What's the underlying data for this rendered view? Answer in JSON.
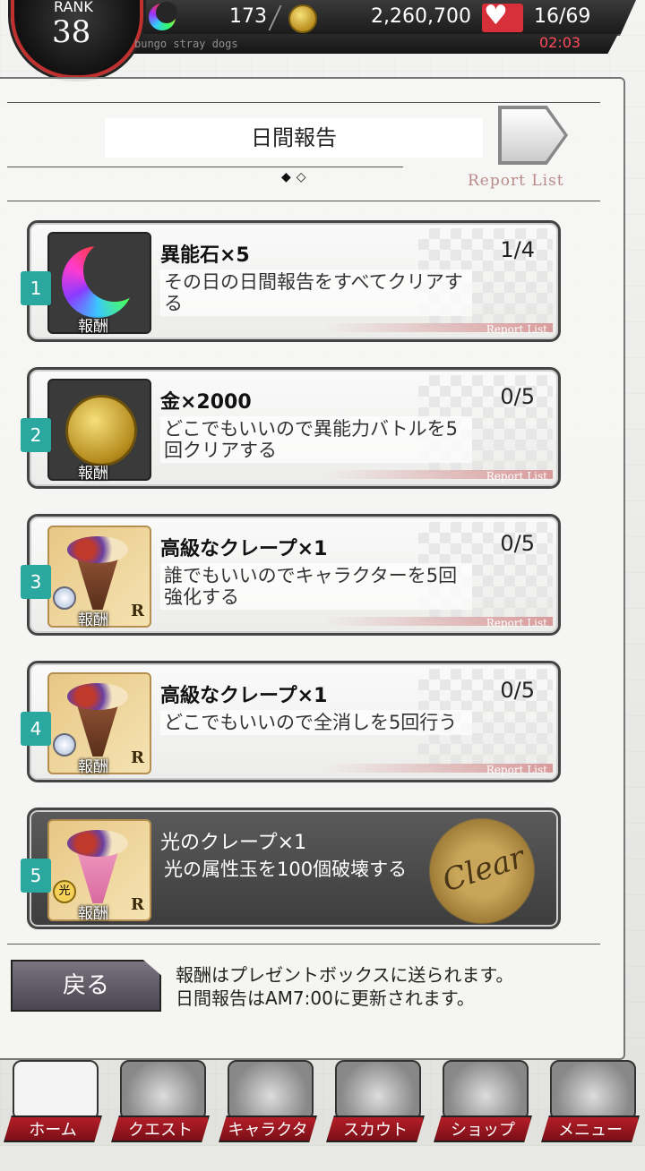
{
  "header": {
    "rank_label": "RANK",
    "rank_value": "38",
    "game_subtitle": "bungo stray dogs",
    "gems": "173",
    "coins": "2,260,700",
    "stamina": "16/69",
    "timer": "02:03",
    "icons": [
      "rainbow-moon-gem-icon",
      "gold-coin-icon",
      "stamina-heart-icon"
    ]
  },
  "report": {
    "title": "日間報告",
    "report_list_link": "Report List",
    "pager": "◆◇"
  },
  "quests": [
    {
      "number": "1",
      "title": "異能石×5",
      "progress": "1/4",
      "description": "その日の日間報告をすべてクリアする",
      "reward_label": "報酬",
      "tag": "Report List",
      "icon": "rainbow-moon-gem-icon",
      "rarity": "",
      "cleared": false
    },
    {
      "number": "2",
      "title": "金×2000",
      "progress": "0/5",
      "description": "どこでもいいので異能力バトルを5回クリアする",
      "reward_label": "報酬",
      "tag": "Report List",
      "icon": "gold-coin-icon",
      "rarity": "",
      "cleared": false
    },
    {
      "number": "3",
      "title": "高級なクレープ×1",
      "progress": "0/5",
      "description": "誰でもいいのでキャラクターを5回強化する",
      "reward_label": "報酬",
      "tag": "Report List",
      "icon": "luxury-crepe-icon",
      "rarity": "R",
      "cleared": false
    },
    {
      "number": "4",
      "title": "高級なクレープ×1",
      "progress": "0/5",
      "description": "どこでもいいので全消しを5回行う",
      "reward_label": "報酬",
      "tag": "Report List",
      "icon": "luxury-crepe-icon",
      "rarity": "R",
      "cleared": false
    },
    {
      "number": "5",
      "title": "光のクレープ×1",
      "progress": "",
      "description": "光の属性玉を100個破壊する",
      "reward_label": "報酬",
      "tag": "",
      "icon": "light-crepe-icon",
      "rarity": "R",
      "cleared": true,
      "stamp": "Clear"
    }
  ],
  "footer": {
    "back_label": "戻る",
    "notice_line1": "報酬はプレゼントボックスに送られます。",
    "notice_line2": "日間報告はAM7:00に更新されます。"
  },
  "nav": {
    "items": [
      {
        "label": "ホーム",
        "icon": "home-icon"
      },
      {
        "label": "クエスト",
        "icon": "tiger-quest-icon"
      },
      {
        "label": "キャラクター",
        "icon": "characters-icon"
      },
      {
        "label": "スカウト",
        "icon": "scout-book-icon"
      },
      {
        "label": "ショップ",
        "icon": "shopping-cart-icon"
      },
      {
        "label": "メニュー",
        "icon": "gear-menu-icon"
      }
    ]
  },
  "colors": {
    "accent_teal": "#2aa8a0",
    "nav_red": "#b41e28",
    "timer_red": "#ff4b5a"
  }
}
